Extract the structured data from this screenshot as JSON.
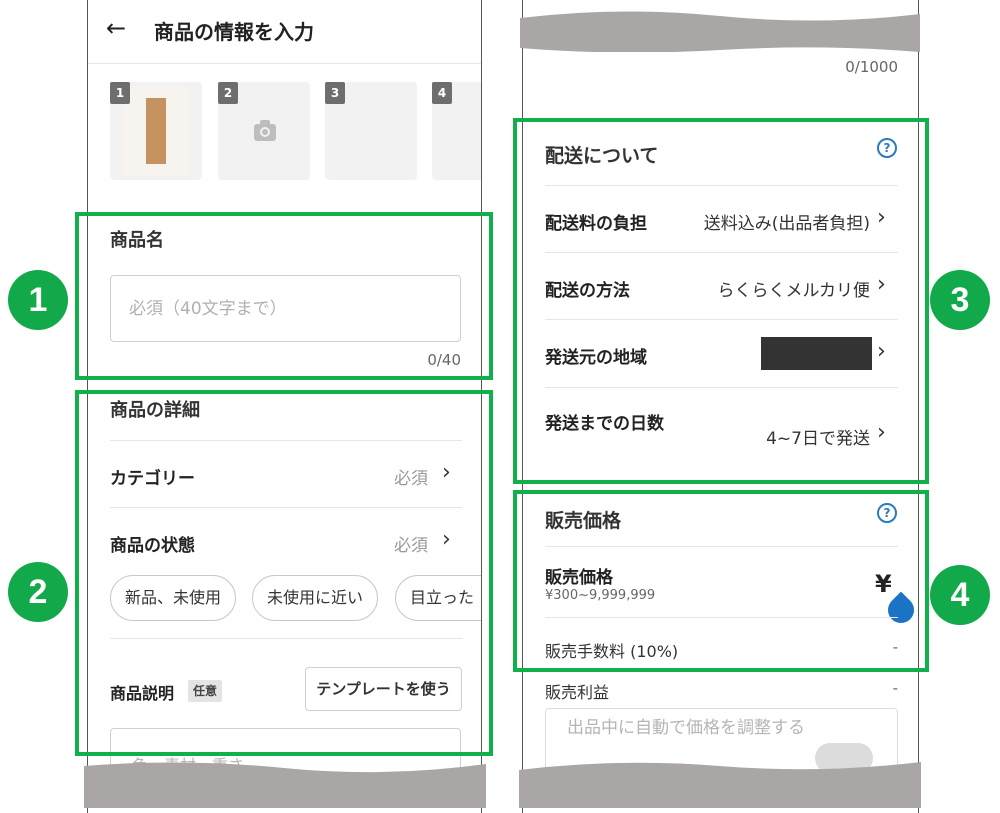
{
  "left_screen": {
    "header": {
      "back_icon": "arrow-left-icon",
      "title": "商品の情報を入力"
    },
    "photos": {
      "slots": [
        "1",
        "2",
        "3",
        "4"
      ],
      "camera_icon": "camera-icon"
    },
    "product_name": {
      "title": "商品名",
      "placeholder": "必須（40文字まで）",
      "counter": "0/40"
    },
    "details": {
      "title": "商品の詳細",
      "category": {
        "label": "カテゴリー",
        "value": "必須"
      },
      "condition": {
        "label": "商品の状態",
        "value": "必須"
      },
      "chips": [
        "新品、未使用",
        "未使用に近い",
        "目立った"
      ],
      "description": {
        "label": "商品説明",
        "badge": "任意",
        "template_button": "テンプレートを使う",
        "hint": "色、素材、重さ、"
      }
    }
  },
  "right_screen": {
    "top_counter": "0/1000",
    "shipping": {
      "title": "配送について",
      "help_icon": "question-circle-icon",
      "rows": [
        {
          "label": "配送料の負担",
          "value": "送料込み(出品者負担)"
        },
        {
          "label": "配送の方法",
          "value": "らくらくメルカリ便"
        },
        {
          "label": "発送元の地域",
          "value": ""
        },
        {
          "label": "発送までの日数",
          "value": "4~7日で発送"
        }
      ]
    },
    "price": {
      "title": "販売価格",
      "help_icon": "question-circle-icon",
      "label": "販売価格",
      "range": "¥300~9,999,999",
      "currency": "¥",
      "fee_label": "販売手数料 (10%)",
      "fee_value": "-",
      "profit_label": "販売利益",
      "profit_value": "-",
      "auto_adjust": "出品中に自動で価格を調整する"
    }
  },
  "annotations": {
    "numbers": [
      "1",
      "2",
      "3",
      "4"
    ],
    "highlight_color": "#12b04a",
    "badge_color": "#11a94a"
  }
}
